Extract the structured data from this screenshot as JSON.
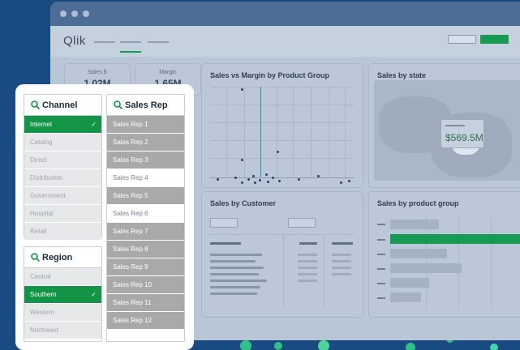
{
  "colors": {
    "accent_green": "#139447",
    "background_blue": "#1a4a82"
  },
  "app": {
    "logo": "Qlik"
  },
  "kpis": [
    {
      "label": "Sales $",
      "value": "1.02M"
    },
    {
      "label": "Margin",
      "value": "1.65M"
    }
  ],
  "charts": {
    "scatter_title": "Sales vs Margin by Product Group",
    "map_title": "Sales by state",
    "map_tooltip_value": "$569.5M",
    "customer_title": "Sales by Customer",
    "product_title": "Sales by product group"
  },
  "filters": {
    "channel": {
      "title": "Channel",
      "items": [
        {
          "label": "Internet",
          "state": "selected"
        },
        {
          "label": "Catalog",
          "state": "alternative"
        },
        {
          "label": "Direct",
          "state": "alternative"
        },
        {
          "label": "Distribution",
          "state": "alternative"
        },
        {
          "label": "Government",
          "state": "alternative"
        },
        {
          "label": "Hospital",
          "state": "alternative"
        },
        {
          "label": "Retail",
          "state": "alternative"
        }
      ]
    },
    "region": {
      "title": "Region",
      "items": [
        {
          "label": "Central",
          "state": "alternative"
        },
        {
          "label": "Southern",
          "state": "selected"
        },
        {
          "label": "Western",
          "state": "alternative"
        },
        {
          "label": "Northeast",
          "state": "alternative"
        }
      ]
    },
    "sales_rep": {
      "title": "Sales Rep",
      "items": [
        {
          "label": "Sales Rep 1",
          "state": "excluded"
        },
        {
          "label": "Sales Rep 2",
          "state": "excluded"
        },
        {
          "label": "Sales Rep 3",
          "state": "excluded"
        },
        {
          "label": "Sales Rep 4",
          "state": "possible"
        },
        {
          "label": "Sales Rep 5",
          "state": "excluded"
        },
        {
          "label": "Sales Rep 6",
          "state": "possible"
        },
        {
          "label": "Sales Rep 7",
          "state": "excluded"
        },
        {
          "label": "Sales Rep 8",
          "state": "excluded"
        },
        {
          "label": "Sales Rep 9",
          "state": "excluded"
        },
        {
          "label": "Sales Rep 10",
          "state": "excluded"
        },
        {
          "label": "Sales Rep 11",
          "state": "excluded"
        },
        {
          "label": "Sales Rep 12",
          "state": "excluded"
        }
      ]
    },
    "check_glyph": "✓"
  }
}
